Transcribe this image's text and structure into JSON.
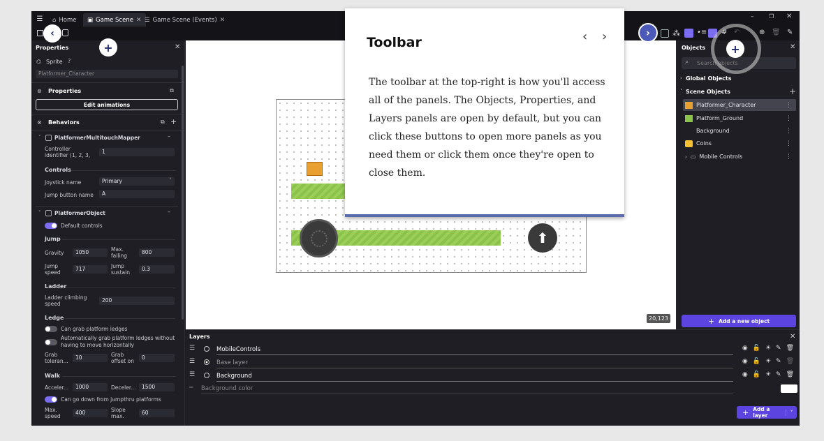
{
  "tabs": [
    {
      "label": "Home",
      "icon": "home-icon"
    },
    {
      "label": "Game Scene",
      "icon": "scene-icon"
    },
    {
      "label": "Game Scene (Events)",
      "icon": "events-icon"
    }
  ],
  "window": {
    "minimize": "–",
    "restore": "❐",
    "close": "✕"
  },
  "props": {
    "title": "Properties",
    "sprite_label": "Sprite",
    "object_name": "Platformer_Character",
    "properties_section": "Properties",
    "edit_animations": "Edit animations",
    "behaviors_section": "Behaviors",
    "mapper": {
      "title": "PlatformerMultitouchMapper",
      "controller_label": "Controller identifier (1, 2, 3,",
      "controller_value": "1",
      "controls_heading": "Controls",
      "joystick_label": "Joystick name",
      "joystick_value": "Primary",
      "jump_button_label": "Jump button name",
      "jump_button_value": "A"
    },
    "platformer": {
      "title": "PlatformerObject",
      "default_controls": "Default controls",
      "jump_heading": "Jump",
      "gravity_label": "Gravity",
      "gravity_value": "1050",
      "maxfalling_label": "Max. falling",
      "maxfalling_value": "800",
      "jumpspeed_label": "Jump speed",
      "jumpspeed_value": "717",
      "jumpsustain_label": "Jump sustain",
      "jumpsustain_value": "0.3",
      "ladder_heading": "Ladder",
      "ladder_label": "Ladder climbing speed",
      "ladder_value": "200",
      "ledge_heading": "Ledge",
      "grab_ledges": "Can grab platform ledges",
      "auto_grab": "Automatically grab platform ledges without having to move horizontally",
      "grab_tolerance_label": "Grab toleran...",
      "grab_tolerance_value": "10",
      "grab_offset_label": "Grab offset on",
      "grab_offset_value": "0",
      "walk_heading": "Walk",
      "accel_label": "Acceler...",
      "accel_value": "1000",
      "decel_label": "Deceler...",
      "decel_value": "1500",
      "jumpthru": "Can go down from jumpthru platforms",
      "maxspeed_label": "Max. speed",
      "maxspeed_value": "400",
      "slope_label": "Slope max.",
      "slope_value": "60"
    }
  },
  "canvas": {
    "coords": "20,123"
  },
  "objects": {
    "title": "Objects",
    "search_placeholder": "Search objects",
    "global_objects": "Global Objects",
    "scene_objects": "Scene Objects",
    "items": [
      {
        "name": "Platformer_Character",
        "color": "#e8a030"
      },
      {
        "name": "Platform_Ground",
        "color": "#8bc34a"
      },
      {
        "name": "Background",
        "color": ""
      },
      {
        "name": "Coins",
        "color": "#f6c030"
      },
      {
        "name": "Mobile Controls",
        "color": ""
      }
    ],
    "add_button": "Add a new object"
  },
  "layers": {
    "title": "Layers",
    "rows": [
      {
        "name": "MobileControls"
      },
      {
        "name": "Base layer"
      },
      {
        "name": "Background"
      }
    ],
    "bg_color_label": "Background color",
    "add_button": "Add a layer"
  },
  "tooltip": {
    "title": "Toolbar",
    "body": "The toolbar at the top-right is how you'll access all of the panels. The Objects, Properties, and Layers panels are open by default, but you can click these buttons to open more panels as you need them or click them once they're open to close them."
  },
  "colors": {
    "accent": "#5b44e0",
    "toggle_on": "#7b6cf0",
    "ground": "#8bc34a",
    "tooltip_border": "#5a6aaa"
  }
}
